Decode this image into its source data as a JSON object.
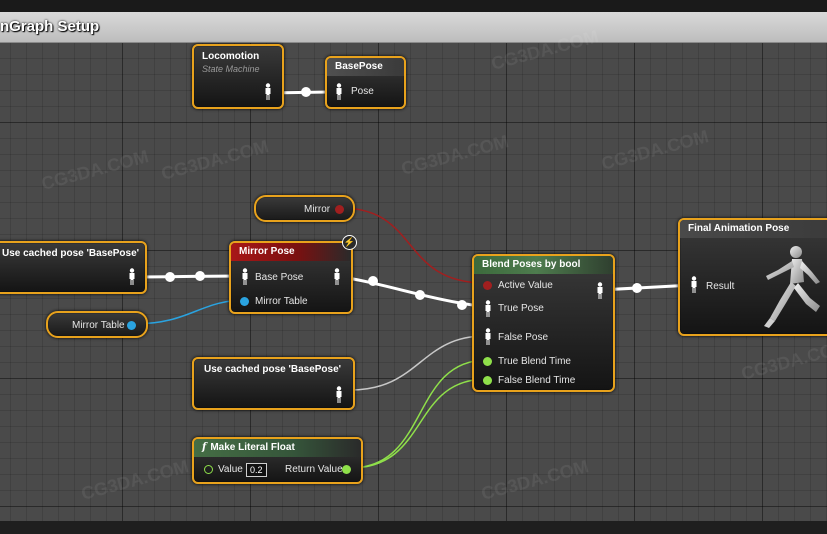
{
  "graph_title": "nGraph Setup",
  "watermark": "CG3DA.COM",
  "colors": {
    "node_border": "#e8a21c",
    "exec_wire": "#ffffff",
    "bool_wire": "#a11f1f",
    "float_wire": "#8fe04a",
    "mirror_table_wire": "#2aa3e0",
    "pose_wire_gray": "#c8c8c8"
  },
  "nodes": {
    "locomotion": {
      "title": "Locomotion",
      "subtitle": "State Machine"
    },
    "base_pose": {
      "title": "BasePose",
      "pin_pose": "Pose"
    },
    "mirror_var": {
      "label": "Mirror"
    },
    "cached_left": {
      "title": "Use cached pose 'BasePose'"
    },
    "mirror_pose": {
      "title": "Mirror Pose",
      "pin_base_pose": "Base Pose",
      "pin_mirror_table": "Mirror Table"
    },
    "mirror_table_var": {
      "label": "Mirror Table"
    },
    "blend": {
      "title": "Blend Poses by bool",
      "pins": [
        "Active Value",
        "True Pose",
        "False Pose",
        "True Blend Time",
        "False Blend Time"
      ]
    },
    "cached_mid": {
      "title": "Use cached pose 'BasePose'"
    },
    "literal_float": {
      "title": "Make Literal Float",
      "value_label": "Value",
      "value": "0.2",
      "return_label": "Return Value"
    },
    "final": {
      "title": "Final Animation Pose",
      "pin_result": "Result"
    }
  }
}
